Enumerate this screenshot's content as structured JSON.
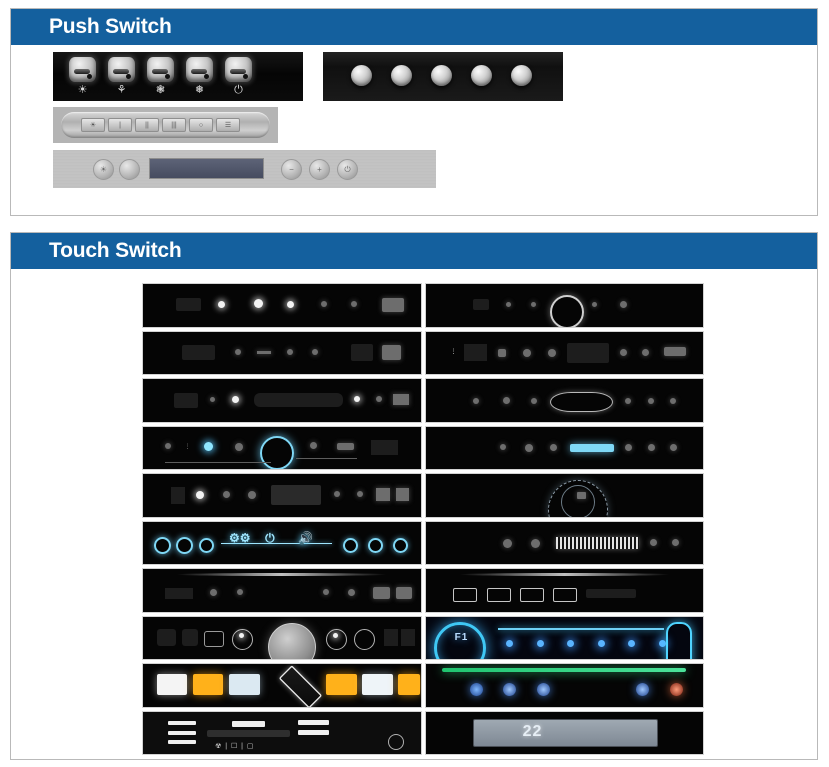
{
  "page": {
    "background": "#ffffff",
    "accent_blue": "#14609e",
    "border_gray": "#b9b9b9"
  },
  "sections": [
    {
      "id": "push",
      "title": "Push Switch",
      "panels": [
        {
          "name": "black-rocker-panel",
          "type": "black-rocker",
          "buttons": [
            {
              "icon": "light-bulb-icon",
              "glyph": "☀"
            },
            {
              "icon": "fan-speed-1-icon",
              "glyph": "⚘"
            },
            {
              "icon": "fan-speed-2-icon",
              "glyph": "❃"
            },
            {
              "icon": "fan-speed-3-icon",
              "glyph": "❅"
            },
            {
              "icon": "power-icon",
              "glyph": "⏻"
            }
          ]
        },
        {
          "name": "black-round-button-panel",
          "type": "black-round",
          "button_count": 5
        },
        {
          "name": "gray-strip-panel",
          "type": "gray-strip",
          "keys": [
            {
              "label": "☀"
            },
            {
              "label": "|"
            },
            {
              "label": "||"
            },
            {
              "label": "|||"
            },
            {
              "label": "○"
            },
            {
              "label": "☰"
            }
          ]
        },
        {
          "name": "steel-bar-lcd-panel",
          "type": "steel-lcd",
          "left_buttons": [
            {
              "icon": "light-icon",
              "glyph": "☀"
            },
            {
              "icon": "blank-icon",
              "glyph": ""
            }
          ],
          "display": {
            "name": "lcd-display",
            "value": ""
          },
          "right_buttons": [
            {
              "icon": "minus-icon",
              "glyph": "−"
            },
            {
              "icon": "plus-icon",
              "glyph": "+"
            },
            {
              "icon": "power-icon",
              "glyph": "⏻"
            }
          ]
        }
      ]
    },
    {
      "id": "touch",
      "title": "Touch Switch",
      "grid": {
        "columns": 2,
        "rows": 10,
        "cells": [
          {
            "name": "touch-panel-01",
            "style": "dark-dots",
            "accent": "#f3f3f3"
          },
          {
            "name": "touch-panel-02",
            "style": "dark-center-ring",
            "accent": "#bdbdbd"
          },
          {
            "name": "touch-panel-03",
            "style": "dark-icons-row",
            "accent": "#d8d8d8"
          },
          {
            "name": "touch-panel-04",
            "style": "dark-window-row",
            "accent": "#cfcfcf"
          },
          {
            "name": "touch-panel-05",
            "style": "dark-slider",
            "accent": "#bdbdbd"
          },
          {
            "name": "touch-panel-06",
            "style": "dark-arc-display",
            "accent": "#c9c9c9"
          },
          {
            "name": "touch-panel-07",
            "style": "cyan-ring-row",
            "accent": "#8fe6ff"
          },
          {
            "name": "touch-panel-08",
            "style": "cyan-readout-row",
            "accent": "#8fe6ff"
          },
          {
            "name": "touch-panel-09",
            "style": "dark-window-row",
            "accent": "#cfcfcf"
          },
          {
            "name": "touch-panel-10",
            "style": "dial-ring",
            "accent": "#9fb6c4"
          },
          {
            "name": "touch-panel-11",
            "style": "cyan-dashboard",
            "accent": "#7fe0ff"
          },
          {
            "name": "touch-panel-12",
            "style": "bar-segments",
            "accent": "#e4e4e4"
          },
          {
            "name": "touch-panel-13",
            "style": "sheen-dots",
            "accent": "#cfcfcf"
          },
          {
            "name": "touch-panel-14",
            "style": "sheen-icons",
            "accent": "#dcdcdc"
          },
          {
            "name": "touch-panel-15",
            "style": "big-dial",
            "accent": "#cccccc"
          },
          {
            "name": "touch-panel-16",
            "style": "blue-f1-panel",
            "accent": "#4fd4ff",
            "readout": "F1"
          },
          {
            "name": "touch-panel-17",
            "style": "amber-squares",
            "accent": "#ffb11a"
          },
          {
            "name": "touch-panel-18",
            "style": "green-bar-panel",
            "accent": "#31d77e"
          },
          {
            "name": "touch-panel-19",
            "style": "white-menu-panel",
            "accent": "#ffffff"
          },
          {
            "name": "touch-panel-20",
            "style": "lcd-panel",
            "accent": "#c9d3db",
            "readout": "22"
          }
        ]
      }
    }
  ]
}
